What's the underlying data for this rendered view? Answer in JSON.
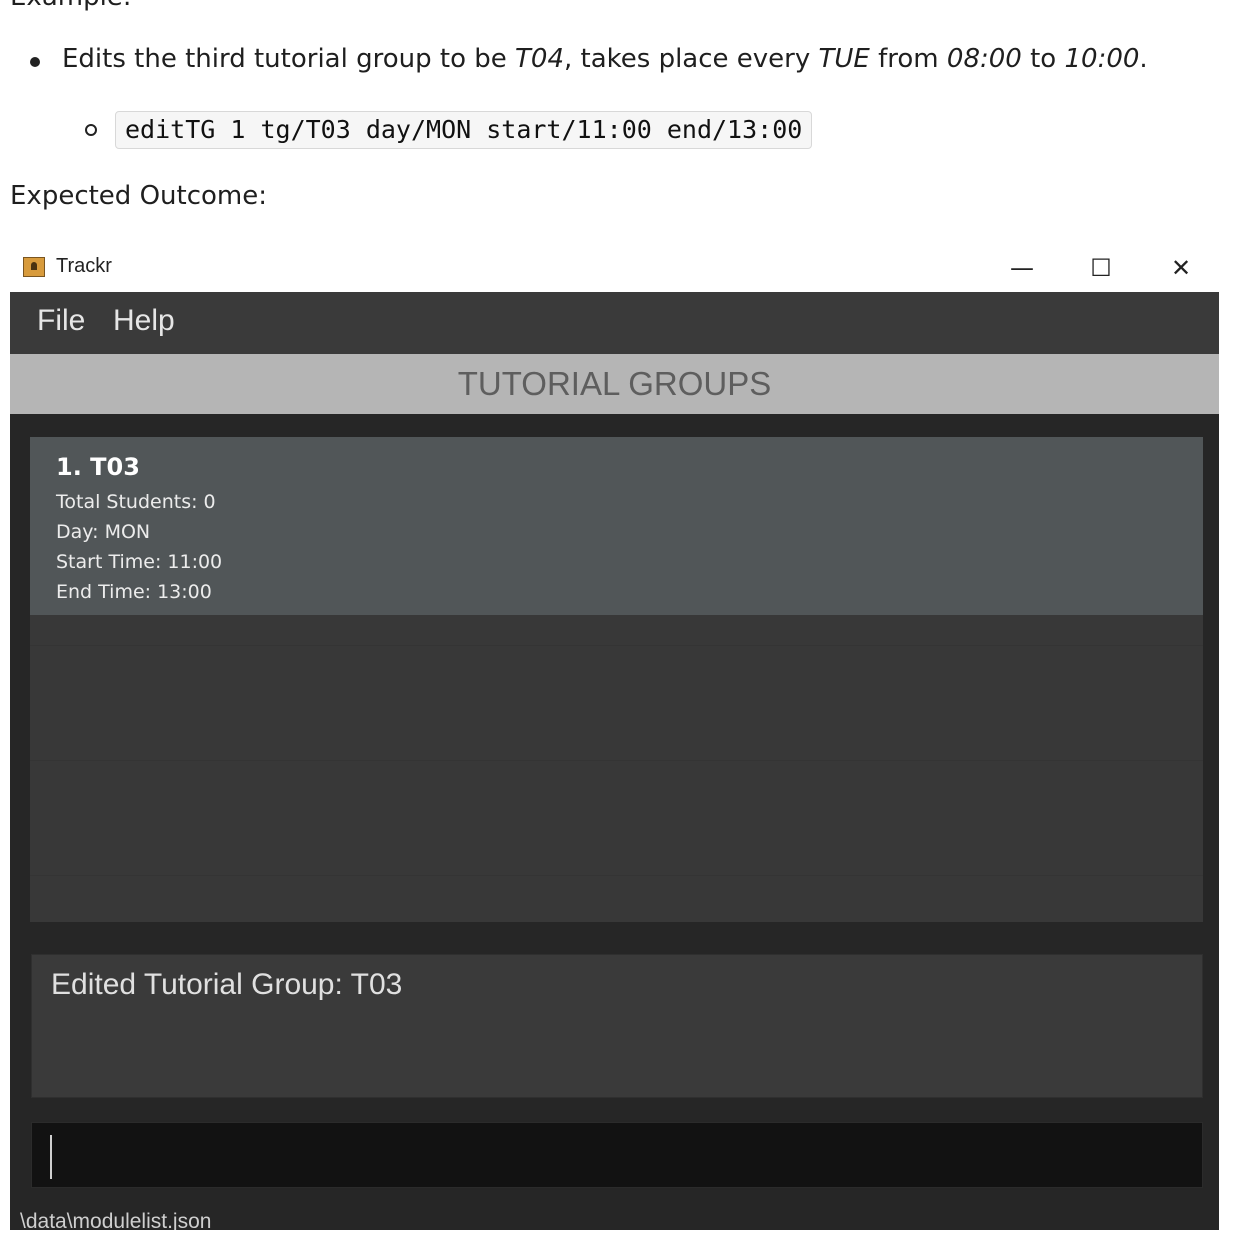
{
  "doc": {
    "top_partial": "Example:",
    "bullet_prefix": "Edits the third tutorial group to be ",
    "bullet_group": "T04",
    "bullet_mid1": ", takes place every ",
    "bullet_day": "TUE",
    "bullet_mid2": " from ",
    "bullet_start": "08:00",
    "bullet_mid3": " to ",
    "bullet_end": "10:00",
    "bullet_suffix": ".",
    "command": "editTG 1 tg/T03 day/MON start/11:00 end/13:00",
    "expected_outcome": "Expected Outcome:"
  },
  "window": {
    "title": "Trackr",
    "icon": "app-person-icon",
    "controls": {
      "minimize": "—",
      "maximize": "☐",
      "close": "✕"
    }
  },
  "menu": {
    "file": "File",
    "help": "Help"
  },
  "section_header": "TUTORIAL GROUPS",
  "tutorial_groups": [
    {
      "title": "1.  T03",
      "total_students": "Total Students: 0",
      "day": "Day: MON",
      "start_time": "Start Time: 11:00",
      "end_time": "End Time: 13:00"
    }
  ],
  "result_message": "Edited Tutorial Group: T03",
  "command_input": {
    "value": "",
    "placeholder": ""
  },
  "status_bar": "\\data\\modulelist.json",
  "colors": {
    "window_bg": "#262626",
    "menubar": "#3a3a3a",
    "header_bg": "#b5b5b5",
    "card_selected": "#515658",
    "command_bg": "#121212"
  }
}
